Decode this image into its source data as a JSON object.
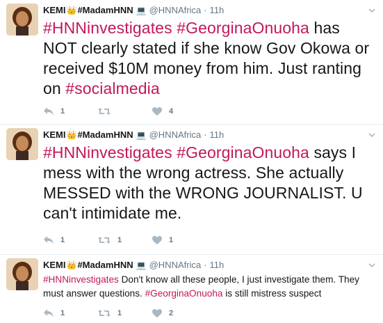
{
  "tweets": [
    {
      "author": {
        "name": "KEMI",
        "crown": "👑",
        "display_suffix": "#MadamHNN",
        "laptop": "💻",
        "handle": "@HNNAfrica"
      },
      "dot": "·",
      "time": "11h",
      "segments": [
        {
          "text": "#HNNinvestigates",
          "hashtag": true
        },
        {
          "text": " ",
          "hashtag": false
        },
        {
          "text": "#GeorginaOnuoha",
          "hashtag": true
        },
        {
          "text": " has NOT clearly stated if she know Gov Okowa or received $10M money from him. Just ranting on ",
          "hashtag": false
        },
        {
          "text": "#socialmedia",
          "hashtag": true
        }
      ],
      "replies": "1",
      "retweets": "",
      "likes": "4"
    },
    {
      "author": {
        "name": "KEMI",
        "crown": "👑",
        "display_suffix": "#MadamHNN",
        "laptop": "💻",
        "handle": "@HNNAfrica"
      },
      "dot": "·",
      "time": "11h",
      "segments": [
        {
          "text": "#HNNinvestigates",
          "hashtag": true
        },
        {
          "text": " ",
          "hashtag": false
        },
        {
          "text": "#GeorginaOnuoha",
          "hashtag": true
        },
        {
          "text": " says I mess with the wrong actress. She actually MESSED with the WRONG JOURNALIST. U can't intimidate me.",
          "hashtag": false
        }
      ],
      "replies": "1",
      "retweets": "1",
      "likes": "1"
    },
    {
      "author": {
        "name": "KEMI",
        "crown": "👑",
        "display_suffix": "#MadamHNN",
        "laptop": "💻",
        "handle": "@HNNAfrica"
      },
      "dot": "·",
      "time": "11h",
      "segments": [
        {
          "text": "#HNNinvestigates",
          "hashtag": true
        },
        {
          "text": " Don't know all these people, I just investigate them. They must answer questions. ",
          "hashtag": false
        },
        {
          "text": "#GeorginaOnuoha",
          "hashtag": true
        },
        {
          "text": " is still mistress suspect",
          "hashtag": false
        }
      ],
      "replies": "1",
      "retweets": "1",
      "likes": "2"
    }
  ],
  "colors": {
    "hashtag": "#c2185b",
    "meta": "#657786",
    "icon": "#aab8c2"
  }
}
